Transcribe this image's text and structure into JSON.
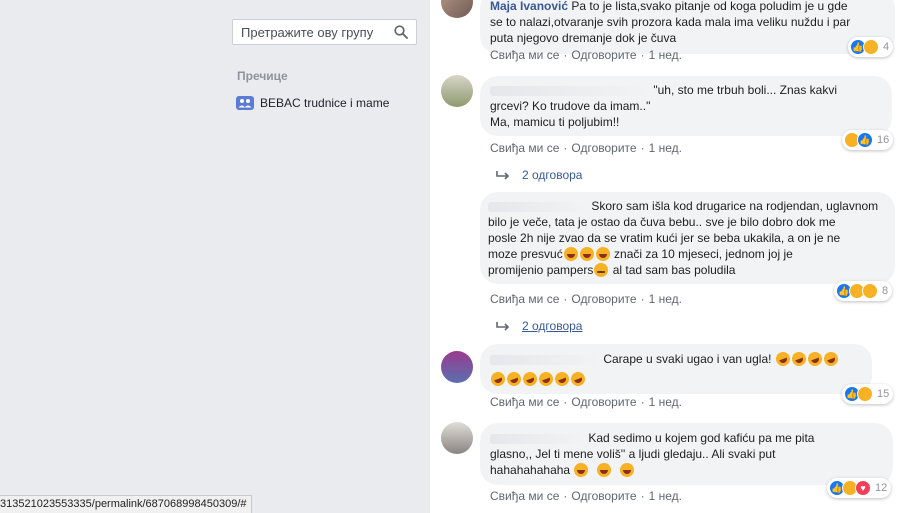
{
  "sidebar": {
    "search_placeholder": "Претражите ову групу",
    "shortcuts_heading": "Пречице",
    "shortcut_items": [
      {
        "label": "BEBAC trudnice i mame",
        "icon": "group-icon"
      }
    ]
  },
  "status_bar": {
    "url": "313521023553335/permalink/687068998450309/#"
  },
  "labels": {
    "like": "Свиђа ми се",
    "reply": "Одговорите",
    "time": "1 нед."
  },
  "comments": [
    {
      "author": "Maja Ivanović",
      "text_lines": [
        "Pa to je lista,svako pitanje od koga poludim je u gde",
        "se to nalazi,otvaranje svih prozora kada mala ima veliku nuždu i par",
        "puta njegovo dremanje dok je čuva"
      ],
      "reactions": {
        "icons": [
          "like-icon",
          "haha-icon"
        ],
        "count": "4"
      }
    },
    {
      "text_lines": [
        "\"uh, sto me trbuh boli... Znas kakvi",
        "grcevi? Ko trudove da imam..\"",
        "Ma, mamicu ti poljubim!!"
      ],
      "reactions": {
        "icons": [
          "haha-icon",
          "like-icon"
        ],
        "count": "16"
      },
      "replies": "2 одговора"
    },
    {
      "text_lines": [
        "Skoro sam išla kod drugarice na rodjendan, uglavnom",
        "bilo je veče, tata je ostao da čuva bebu.. sve je bilo dobro dok me",
        "posle 2h nije zvao da se vratim kući jer se beba ukakila, a on je ne",
        "moze presvuć",
        "znači za 10 mjeseci, jednom joj je",
        "promijenio pampers",
        "al tad sam bas poludila"
      ],
      "reactions": {
        "icons": [
          "like-icon",
          "sad-icon",
          "haha-icon"
        ],
        "count": "8"
      },
      "replies": "2 одговора"
    },
    {
      "text_lines": [
        "Carape u svaki ugao i van ugla!"
      ],
      "reactions": {
        "icons": [
          "like-icon",
          "haha-icon"
        ],
        "count": "15"
      }
    },
    {
      "text_lines": [
        "Kad sedimo u kojem god kafiću pa me pita",
        "glasno,, Jel ti mene voliš'' a ljudi gledaju.. Ali svaki put",
        "hahahahahaha"
      ],
      "reactions": {
        "icons": [
          "like-icon",
          "haha-icon",
          "love-icon"
        ],
        "count": "12"
      }
    }
  ],
  "colors": {
    "like": "#1877f2",
    "haha": "#f7b125",
    "love": "#f33e58",
    "link": "#385898",
    "bubble": "#f2f3f5"
  }
}
